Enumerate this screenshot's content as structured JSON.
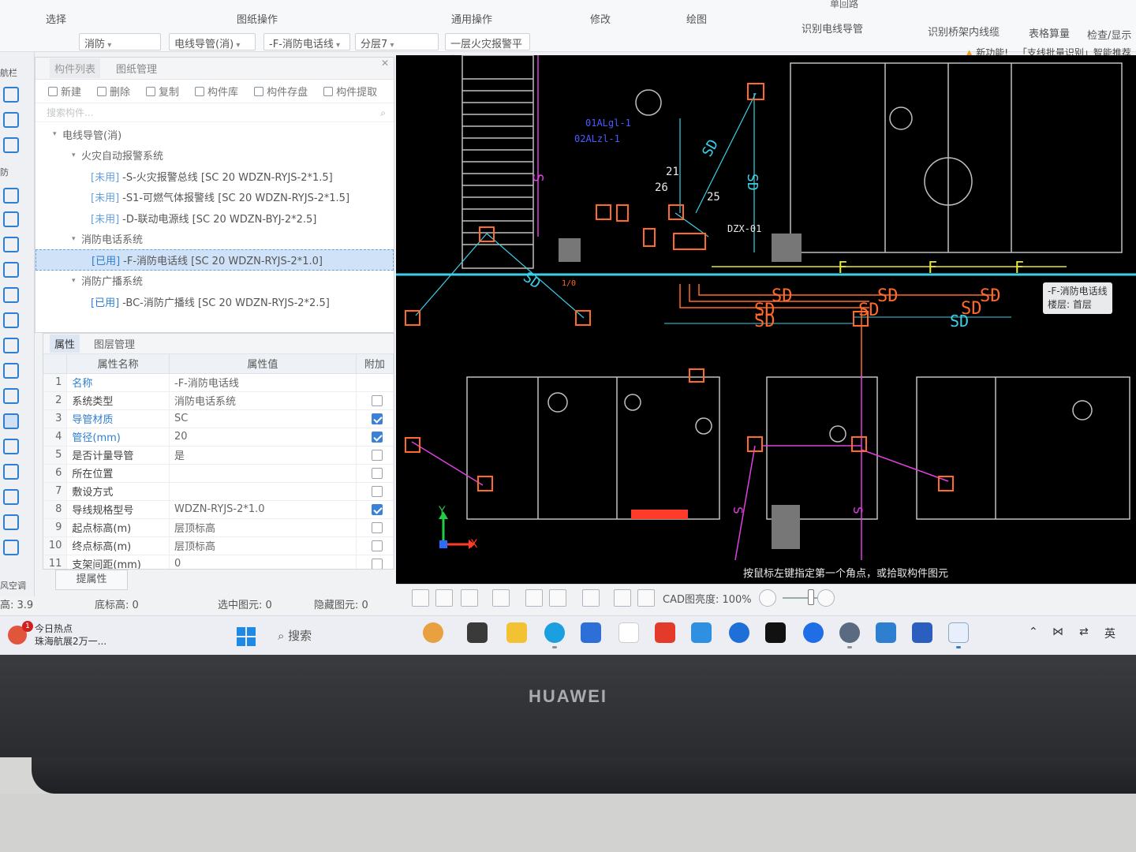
{
  "ribbon": {
    "top_labels": [
      "单回路"
    ],
    "groups": [
      "选择",
      "图纸操作",
      "通用操作",
      "修改",
      "绘图",
      "识别电线导管",
      "识别桥架内线缆",
      "表格算量",
      "检查/显示"
    ],
    "dropdowns": [
      "消防",
      "电线导管(消)",
      "-F-消防电话线",
      "分层7",
      "一层火灾报警平"
    ],
    "notice_new": "新功能!",
    "notice_text": "「支线批量识别」智能推荐"
  },
  "left_toolbar": {
    "labels": [
      "航栏",
      "防",
      "风空调"
    ]
  },
  "component_panel": {
    "tabs": [
      "构件列表",
      "图纸管理"
    ],
    "toolbar": [
      "新建",
      "删除",
      "复制",
      "构件库",
      "构件存盘",
      "构件提取"
    ],
    "search_placeholder": "搜索构件...",
    "tree": [
      {
        "level": 0,
        "type": "group",
        "label": "电线导管(消)"
      },
      {
        "level": 1,
        "type": "group",
        "label": "火灾自动报警系统"
      },
      {
        "level": 2,
        "type": "item",
        "status": "[未用]",
        "label": "-S-火灾报警总线 [SC 20 WDZN-RYJS-2*1.5]"
      },
      {
        "level": 2,
        "type": "item",
        "status": "[未用]",
        "label": "-S1-可燃气体报警线 [SC 20 WDZN-RYJS-2*1.5]"
      },
      {
        "level": 2,
        "type": "item",
        "status": "[未用]",
        "label": "-D-联动电源线 [SC 20 WDZN-BYJ-2*2.5]"
      },
      {
        "level": 1,
        "type": "group",
        "label": "消防电话系统"
      },
      {
        "level": 2,
        "type": "item",
        "status": "[已用]",
        "label": "-F-消防电话线 [SC 20 WDZN-RYJS-2*1.0]",
        "selected": true
      },
      {
        "level": 1,
        "type": "group",
        "label": "消防广播系统"
      },
      {
        "level": 2,
        "type": "item",
        "status": "[已用]",
        "label": "-BC-消防广播线 [SC 20 WDZN-RYJS-2*2.5]"
      }
    ]
  },
  "property_panel": {
    "tabs": [
      "属性",
      "图层管理"
    ],
    "headers": [
      "属性名称",
      "属性值",
      "附加"
    ],
    "rows": [
      {
        "num": "1",
        "name": "名称",
        "value": "-F-消防电话线",
        "blue": true,
        "checked": false,
        "has_check": false
      },
      {
        "num": "2",
        "name": "系统类型",
        "value": "消防电话系统",
        "blue": false,
        "checked": false,
        "has_check": true
      },
      {
        "num": "3",
        "name": "导管材质",
        "value": "SC",
        "blue": true,
        "checked": true,
        "has_check": true
      },
      {
        "num": "4",
        "name": "管径(mm)",
        "value": "20",
        "blue": true,
        "checked": true,
        "has_check": true
      },
      {
        "num": "5",
        "name": "是否计量导管",
        "value": "是",
        "blue": false,
        "checked": false,
        "has_check": true
      },
      {
        "num": "6",
        "name": "所在位置",
        "value": "",
        "blue": false,
        "checked": false,
        "has_check": true
      },
      {
        "num": "7",
        "name": "敷设方式",
        "value": "",
        "blue": false,
        "checked": false,
        "has_check": true
      },
      {
        "num": "8",
        "name": "导线规格型号",
        "value": "WDZN-RYJS-2*1.0",
        "blue": false,
        "checked": true,
        "has_check": true
      },
      {
        "num": "9",
        "name": "起点标高(m)",
        "value": "层顶标高",
        "blue": false,
        "checked": false,
        "has_check": true
      },
      {
        "num": "10",
        "name": "终点标高(m)",
        "value": "层顶标高",
        "blue": false,
        "checked": false,
        "has_check": true
      },
      {
        "num": "11",
        "name": "支架间距(mm)",
        "value": "0",
        "blue": false,
        "checked": false,
        "has_check": true
      }
    ],
    "show_props_button": "提属性"
  },
  "statusbar": {
    "floor_height": "高: 3.9",
    "base_height": "底标高: 0",
    "selected": "选中图元: 0",
    "hidden": "隐藏图元: 0"
  },
  "cad": {
    "tooltip_line1": "-F-消防电话线",
    "tooltip_line2": "楼层: 首层",
    "prompt": "按鼠标左键指定第一个角点，或拾取构件图元",
    "labels": {
      "panel1": "01ALgl-1",
      "panel2": "02ALzl-1",
      "n21": "21",
      "n26": "26",
      "n25": "25",
      "dzx": "DZX-01",
      "sd": "SD",
      "s": "S",
      "f": "F",
      "axis_x": "X",
      "axis_y": "Y",
      "io": "1/0"
    }
  },
  "cad_toolbar": {
    "brightness": "CAD图亮度: 100%"
  },
  "taskbar": {
    "news_title": "今日热点",
    "news_sub": "珠海航展2万一...",
    "news_badge": "1",
    "search": "搜索",
    "tray_lang": "英"
  },
  "bezel": {
    "brand": "HUAWEI"
  },
  "colors": {
    "accent": "#2f7fd0",
    "cad_bg": "#000000",
    "cad_orange": "#ff6a2a",
    "cad_magenta": "#e040e0",
    "cad_cyan": "#3ad0e8",
    "cad_yellow": "#e6e63a"
  }
}
